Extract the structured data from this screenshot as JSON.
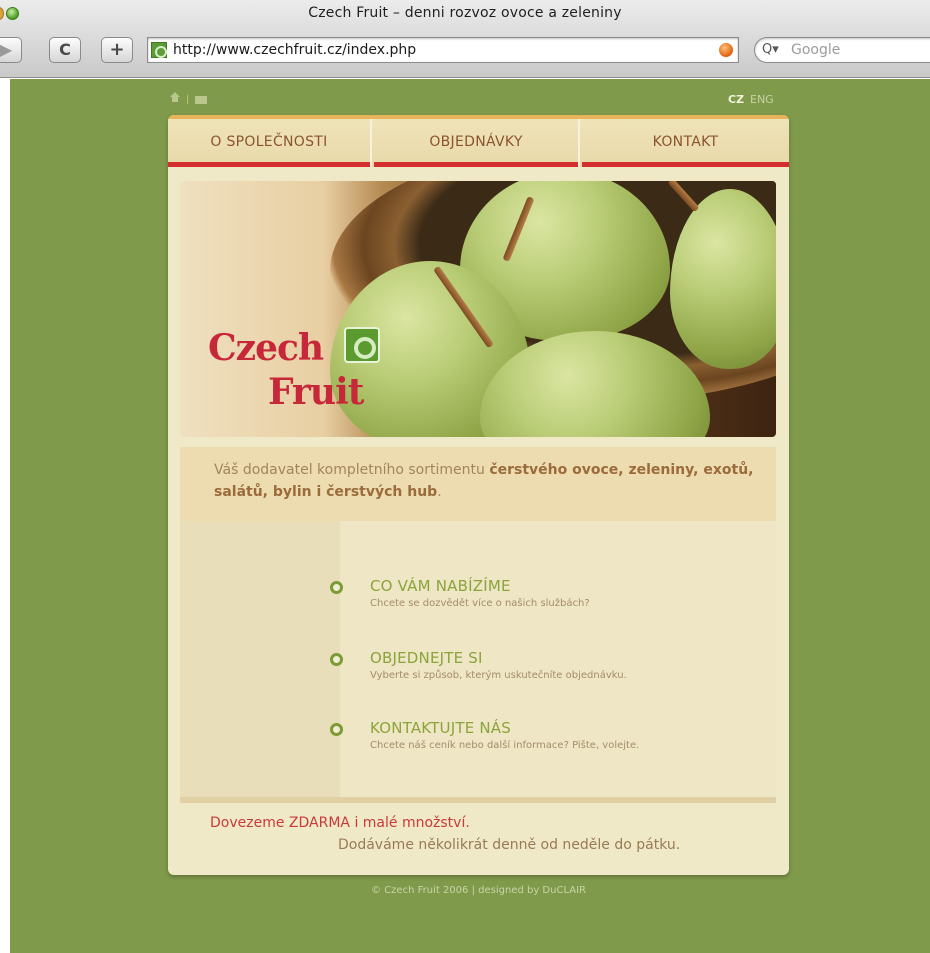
{
  "browser": {
    "window_title": "Czech Fruit – denni rozvoz ovoce a zeleniny",
    "url": "http://www.czechfruit.cz/index.php",
    "search_placeholder": "Google",
    "reload_label": "C",
    "add_label": "+",
    "forward_label": "▶"
  },
  "site": {
    "util": {
      "separator": "|",
      "lang_cz": "CZ",
      "lang_eng": "ENG"
    },
    "nav": [
      {
        "label": "O SPOLEČNOSTI"
      },
      {
        "label": "OBJEDNÁVKY"
      },
      {
        "label": "KONTAKT"
      }
    ],
    "logo": {
      "line1": "Czech",
      "line2": "Fruit"
    },
    "intro": {
      "prefix": "Váš dodavatel kompletního sortimentu ",
      "bold": "čerstvého ovoce, zeleniny, exotů, salátů, bylin i čerstvých hub",
      "suffix": "."
    },
    "links": [
      {
        "title": "CO VÁM NABÍZÍME",
        "sub": "Chcete se dozvědět více o našich službách?"
      },
      {
        "title": "OBJEDNEJTE SI",
        "sub": "Vyberte si způsob, kterým uskutečníte objednávku."
      },
      {
        "title": "KONTAKTUJTE NÁS",
        "sub": "Chcete náš ceník nebo další informace? Pište, volejte."
      }
    ],
    "delivery": {
      "line1": "Dovezeme ZDARMA i malé množství.",
      "line2": "Dodáváme několikrát denně od neděle do pátku."
    },
    "footer": "© Czech Fruit 2006 | designed by DuCLAIR"
  },
  "colors": {
    "background": "#7f9a4a",
    "panel": "#f0e9c8",
    "nav_text": "#8b5430",
    "nav_underline": "#d42e2e",
    "logo_red": "#c6283a",
    "link_green": "#8ba43b"
  },
  "icons": [
    "home-icon",
    "mail-icon",
    "reload-icon",
    "add-tab-icon",
    "forward-icon",
    "rss-icon",
    "search-icon",
    "site-favicon",
    "logo-mark-icon",
    "bullet-icon"
  ]
}
